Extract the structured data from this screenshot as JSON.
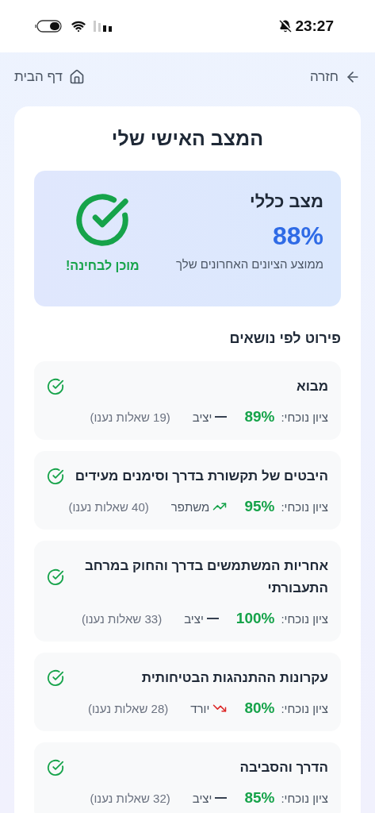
{
  "status_bar": {
    "time": "23:27"
  },
  "nav": {
    "back": "חזרה",
    "home": "דף הבית"
  },
  "title": "המצב האישי שלי",
  "summary": {
    "heading": "מצב כללי",
    "score": "88%",
    "caption": "ממוצע הציונים האחרונים שלך",
    "verdict": "מוכן לבחינה!"
  },
  "section_heading": "פירוט לפי נושאים",
  "topics": [
    {
      "name": "מבוא",
      "score_label": "ציון נוכחי:",
      "score": "89%",
      "kind": "stable",
      "trend_label": "יציב",
      "count": "(19 שאלות נענו)"
    },
    {
      "name": "היבטים של תקשורת בדרך וסימנים מעידים",
      "score_label": "ציון נוכחי:",
      "score": "95%",
      "kind": "up",
      "trend_label": "משתפר",
      "count": "(40 שאלות נענו)"
    },
    {
      "name": "אחריות המשתמשים בדרך והחוק במרחב התעבורתי",
      "score_label": "ציון נוכחי:",
      "score": "100%",
      "kind": "stable",
      "trend_label": "יציב",
      "count": "(33 שאלות נענו)"
    },
    {
      "name": "עקרונות ההתנהגות הבטיחותית",
      "score_label": "ציון נוכחי:",
      "score": "80%",
      "kind": "down",
      "trend_label": "יורד",
      "count": "(28 שאלות נענו)"
    },
    {
      "name": "הדרך והסביבה",
      "score_label": "ציון נוכחי:",
      "score": "85%",
      "kind": "stable",
      "trend_label": "יציב",
      "count": "(32 שאלות נענו)"
    }
  ]
}
